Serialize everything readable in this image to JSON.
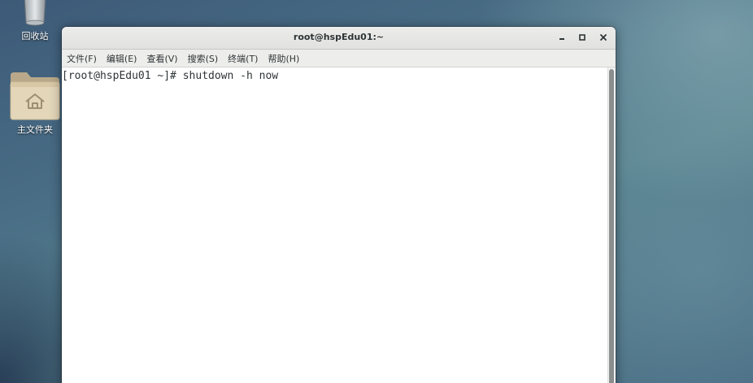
{
  "desktop": {
    "icons": [
      {
        "label": "回收站",
        "icon": "trash-icon"
      },
      {
        "label": "主文件夹",
        "icon": "home-folder-icon"
      }
    ]
  },
  "window": {
    "title": "root@hspEdu01:~",
    "controls": {
      "minimize": "minimize-icon",
      "maximize": "maximize-icon",
      "close": "close-icon"
    }
  },
  "menubar": {
    "items": [
      {
        "label": "文件(F)"
      },
      {
        "label": "编辑(E)"
      },
      {
        "label": "查看(V)"
      },
      {
        "label": "搜索(S)"
      },
      {
        "label": "终端(T)"
      },
      {
        "label": "帮助(H)"
      }
    ]
  },
  "terminal": {
    "prompt": "[root@hspEdu01 ~]# ",
    "command": "shutdown -h now"
  },
  "colors": {
    "terminal_bg": "#ffffff",
    "terminal_text": "#2e3436",
    "titlebar_bg": "#e6e6e4"
  }
}
